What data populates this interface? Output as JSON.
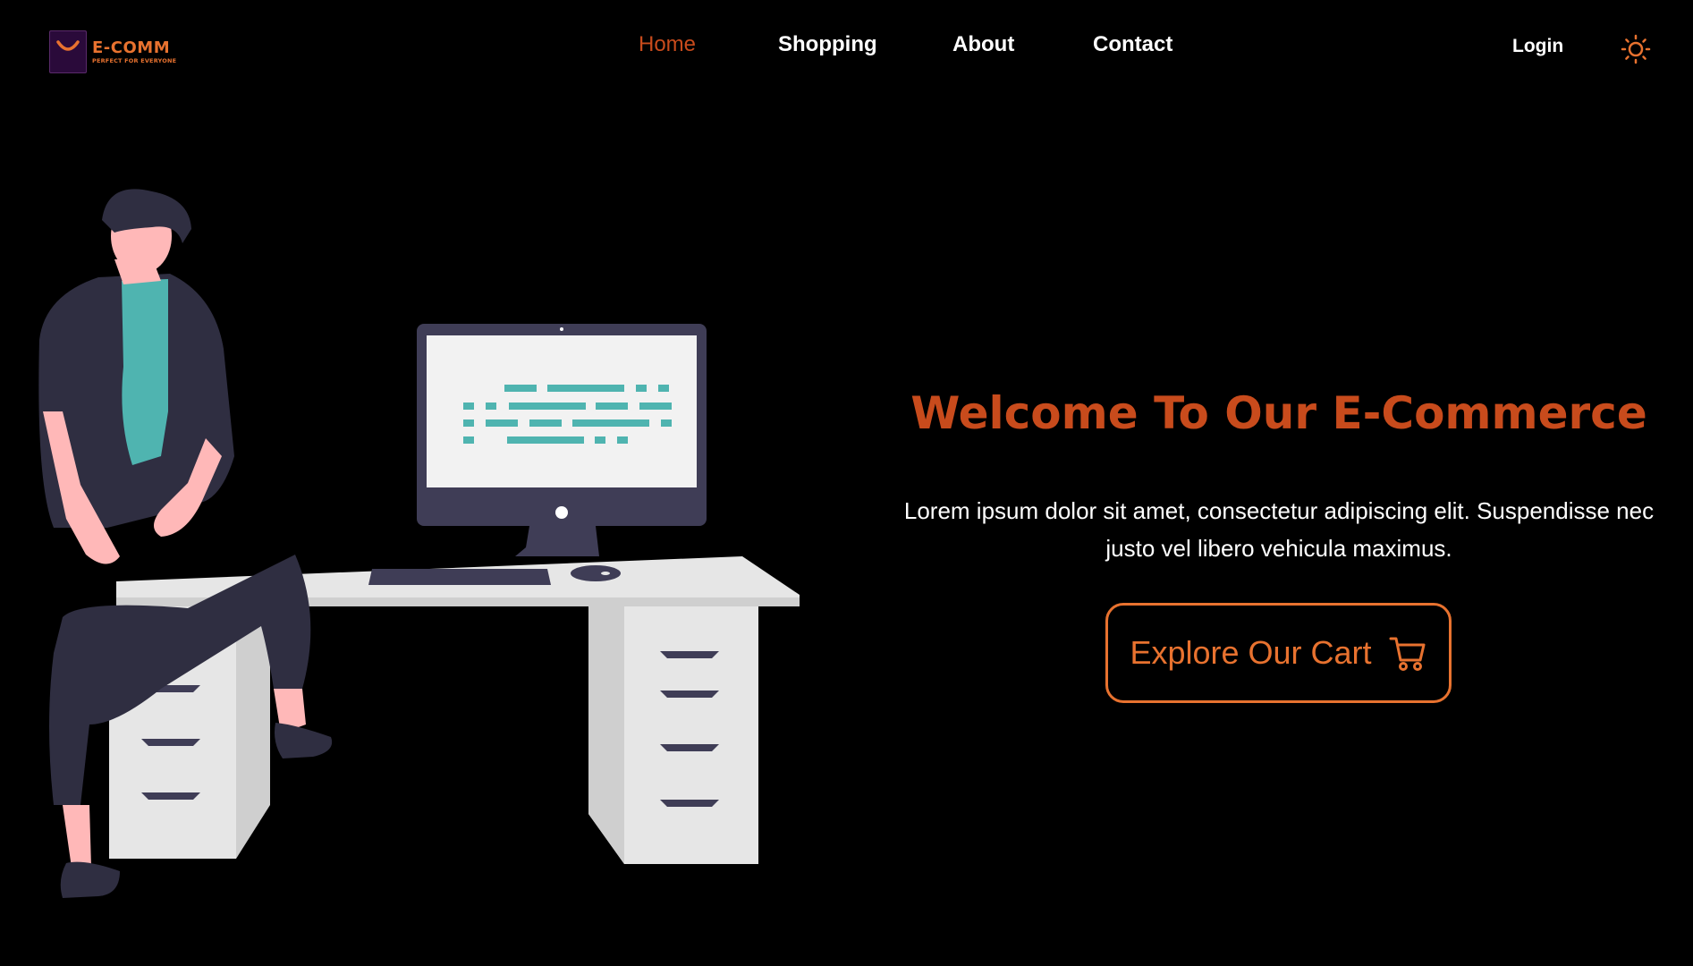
{
  "brand": {
    "title": "E-COMM",
    "tagline": "PERFECT FOR EVERYONE",
    "color": "#e8722f"
  },
  "nav": {
    "items": [
      {
        "label": "Home",
        "active": true
      },
      {
        "label": "Shopping",
        "active": false
      },
      {
        "label": "About",
        "active": false
      },
      {
        "label": "Contact",
        "active": false
      }
    ],
    "login_label": "Login",
    "theme_icon": "sun-icon"
  },
  "hero": {
    "title": "Welcome To Our E-Commerce",
    "description": "Lorem ipsum dolor sit amet, consectetur adipiscing elit. Suspendisse nec justo vel libero vehicula maximus.",
    "cta_label": "Explore Our Cart",
    "cta_icon": "cart-icon"
  },
  "colors": {
    "background": "#000000",
    "accent": "#c84b1c",
    "accent_light": "#e8722f",
    "text": "#ffffff"
  }
}
